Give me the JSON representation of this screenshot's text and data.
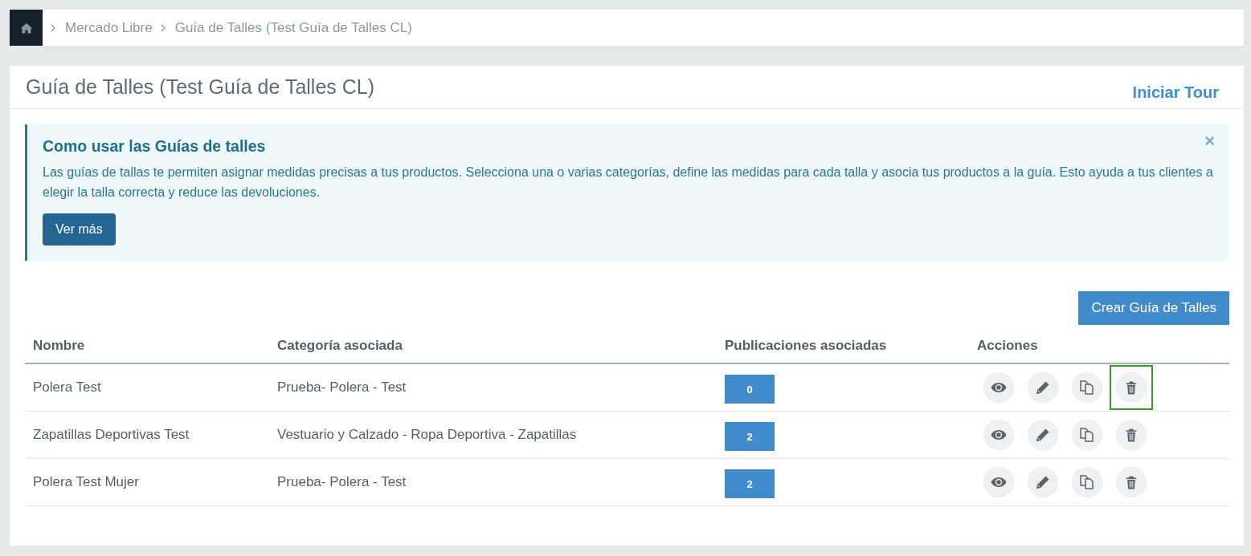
{
  "breadcrumb": {
    "items": [
      "Mercado Libre",
      "Guía de Talles (Test Guía de Talles CL)"
    ]
  },
  "page": {
    "title": "Guía de Talles (Test Guía de Talles CL)",
    "tour_link": "Iniciar Tour"
  },
  "alert": {
    "title": "Como usar las Guías de talles",
    "text": "Las guías de tallas te permiten asignar medidas precisas a tus productos. Selecciona una o varias categorías, define las medidas para cada talla y asocia tus productos a la guía. Esto ayuda a tus clientes a elegir la talla correcta y reduce las devoluciones.",
    "button": "Ver más",
    "close": "×"
  },
  "create_button": "Crear Guía de Talles",
  "table": {
    "columns": [
      "Nombre",
      "Categoría asociada",
      "Publicaciones asociadas",
      "Acciones"
    ],
    "rows": [
      {
        "name": "Polera Test",
        "category": "Prueba- Polera - Test",
        "publications": "0",
        "actions": [
          {
            "kind": "view",
            "focused": false
          },
          {
            "kind": "edit",
            "focused": false
          },
          {
            "kind": "copy",
            "focused": false
          },
          {
            "kind": "delete",
            "focused": true
          }
        ]
      },
      {
        "name": "Zapatillas Deportivas Test",
        "category": "Vestuario y Calzado - Ropa Deportiva - Zapatillas",
        "publications": "2",
        "actions": [
          {
            "kind": "view",
            "focused": false
          },
          {
            "kind": "edit",
            "focused": false
          },
          {
            "kind": "copy",
            "focused": false
          },
          {
            "kind": "delete",
            "focused": false
          }
        ]
      },
      {
        "name": "Polera Test Mujer",
        "category": "Prueba- Polera - Test",
        "publications": "2",
        "actions": [
          {
            "kind": "view",
            "focused": false
          },
          {
            "kind": "edit",
            "focused": false
          },
          {
            "kind": "copy",
            "focused": false
          },
          {
            "kind": "delete",
            "focused": false
          }
        ]
      }
    ]
  }
}
